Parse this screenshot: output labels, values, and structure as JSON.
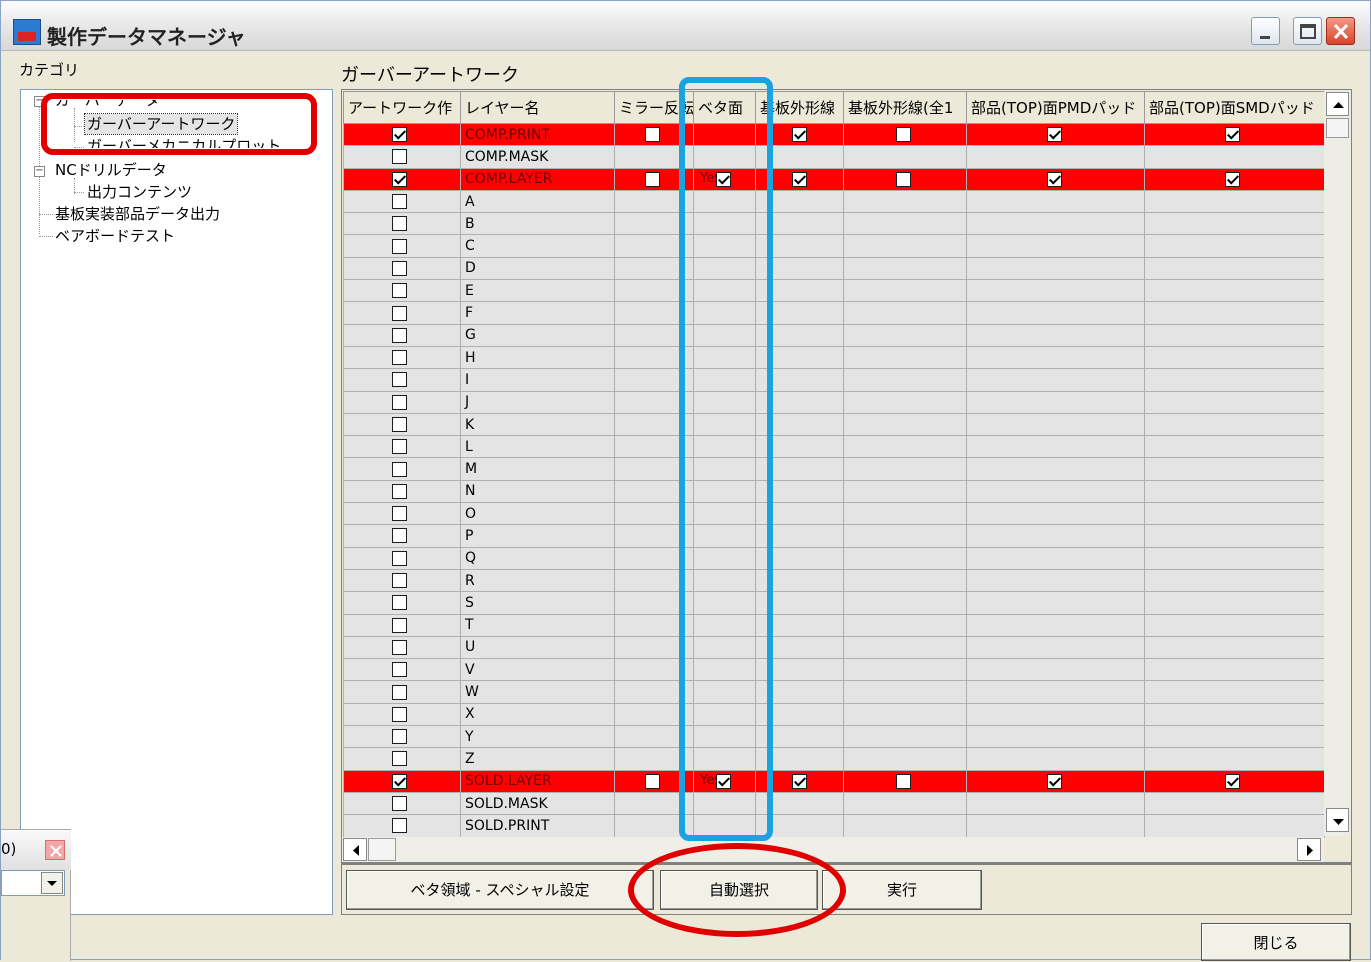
{
  "window": {
    "title": "製作データマネージャ",
    "close_label": "閉じる"
  },
  "category": {
    "label": "カテゴリ",
    "tree": [
      {
        "label": "ガーバーデータ"
      },
      {
        "label": "ガーバーアートワーク",
        "selected": true
      },
      {
        "label": "ガーバーメカニカルプロット"
      },
      {
        "label": "NCドリルデータ"
      },
      {
        "label": "出力コンテンツ"
      },
      {
        "label": "基板実装部品データ出力"
      },
      {
        "label": "ベアボードテスト"
      }
    ]
  },
  "section": {
    "title": "ガーバーアートワーク"
  },
  "grid": {
    "columns": [
      "アートワーク作",
      "レイヤー名",
      "ミラー反転",
      "ベタ面",
      "基板外形線",
      "基板外形線(全1",
      "部品(TOP)面PMDパッド",
      "部品(TOP)面SMDパッド"
    ],
    "rows": [
      {
        "art": true,
        "name": "COMP.PRINT",
        "mirror": false,
        "beta": "",
        "outline": true,
        "outline_all": false,
        "pmd": true,
        "smd": true,
        "highlight": true
      },
      {
        "art": false,
        "name": "COMP.MASK",
        "highlight": false
      },
      {
        "art": true,
        "name": "COMP.LAYER",
        "mirror": false,
        "beta": "Yes",
        "outline": true,
        "outline_all": false,
        "pmd": true,
        "smd": true,
        "highlight": true
      },
      {
        "art": false,
        "name": "A"
      },
      {
        "art": false,
        "name": "B"
      },
      {
        "art": false,
        "name": "C"
      },
      {
        "art": false,
        "name": "D"
      },
      {
        "art": false,
        "name": "E"
      },
      {
        "art": false,
        "name": "F"
      },
      {
        "art": false,
        "name": "G"
      },
      {
        "art": false,
        "name": "H"
      },
      {
        "art": false,
        "name": "I"
      },
      {
        "art": false,
        "name": "J"
      },
      {
        "art": false,
        "name": "K"
      },
      {
        "art": false,
        "name": "L"
      },
      {
        "art": false,
        "name": "M"
      },
      {
        "art": false,
        "name": "N"
      },
      {
        "art": false,
        "name": "O"
      },
      {
        "art": false,
        "name": "P"
      },
      {
        "art": false,
        "name": "Q"
      },
      {
        "art": false,
        "name": "R"
      },
      {
        "art": false,
        "name": "S"
      },
      {
        "art": false,
        "name": "T"
      },
      {
        "art": false,
        "name": "U"
      },
      {
        "art": false,
        "name": "V"
      },
      {
        "art": false,
        "name": "W"
      },
      {
        "art": false,
        "name": "X"
      },
      {
        "art": false,
        "name": "Y"
      },
      {
        "art": false,
        "name": "Z"
      },
      {
        "art": true,
        "name": "SOLD.LAYER",
        "mirror": false,
        "beta": "Yes",
        "outline": true,
        "outline_all": false,
        "pmd": true,
        "smd": true,
        "highlight": true
      },
      {
        "art": false,
        "name": "SOLD.MASK"
      },
      {
        "art": false,
        "name": "SOLD.PRINT"
      }
    ]
  },
  "buttons": {
    "special": "ベタ領域 - スペシャル設定",
    "auto_select": "自動選択",
    "execute": "実行"
  },
  "float_window": {
    "title_fragment": "0)"
  },
  "colors": {
    "highlight_row": "#ff0000",
    "annotation_red": "#e00000",
    "annotation_blue": "#1aa3e0"
  }
}
